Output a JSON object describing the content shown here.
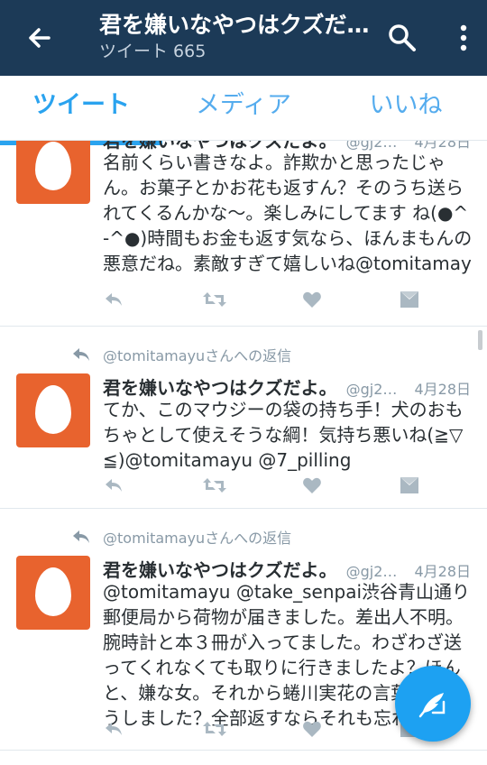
{
  "appbar": {
    "title": "君を嫌いなやつはクズだよ。",
    "subtitle": "ツイート 665",
    "icons": {
      "back": "arrow-back-icon",
      "search": "search-icon",
      "more": "more-vert-icon"
    }
  },
  "tabs": [
    {
      "label": "ツイート",
      "active": true
    },
    {
      "label": "メディア",
      "active": false
    },
    {
      "label": "いいね",
      "active": false
    }
  ],
  "colors": {
    "appbar_bg": "#1c3a57",
    "accent": "#2aa3ef",
    "avatar_bg": "#e8632e",
    "muted": "#8899a6"
  },
  "tweets": [
    {
      "reply_context": "",
      "name": "君を嫌いなやつはクズだよ。",
      "handle": "@gj2m...",
      "date": "4月28日",
      "text": "名前くらい書きなよ。詐欺かと思ったじゃん。お菓子とかお花も返すん？そのうち送られてくるんかな〜。楽しみにしてます ね(●^-^●)時間もお金も返す気なら、ほんまもんの悪意だね。素敵すぎて嬉しいね@tomitamayu"
    },
    {
      "reply_context": "@tomitamayuさんへの返信",
      "name": "君を嫌いなやつはクズだよ。",
      "handle": "@gj2m...",
      "date": "4月28日",
      "text": "てか、このマウジーの袋の持ち手！犬のおもちゃとして使えそうな綱！気持ち悪いね(≧▽≦)@tomitamayu @7_pilling"
    },
    {
      "reply_context": "@tomitamayuさんへの返信",
      "name": "君を嫌いなやつはクズだよ。",
      "handle": "@gj2m...",
      "date": "4月28日",
      "text": "@tomitamayu @take_senpai渋谷青山通り郵便局から荷物が届きました。差出人不明。腕時計と本３冊が入ってました。わざわざ送ってくれなくても取りに行きましたよ？ほんと、嫌な女。それから蜷川実花の言葉集はどうしました？全部返すならそれも忘れずに"
    }
  ],
  "fab": {
    "icon": "compose-tweet-icon"
  }
}
